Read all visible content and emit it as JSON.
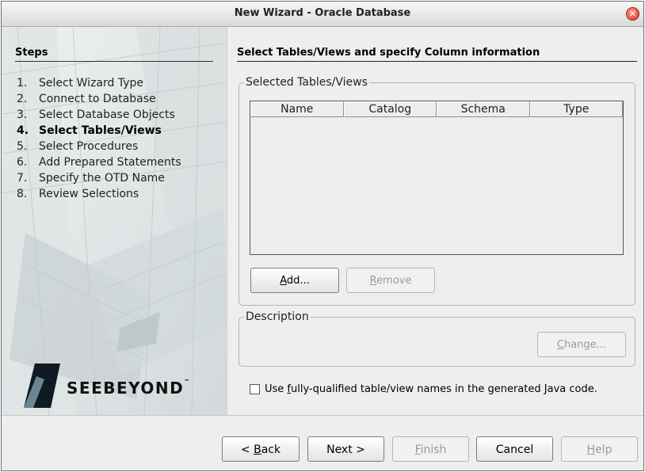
{
  "window": {
    "title": "New Wizard - Oracle Database"
  },
  "steps_panel": {
    "title": "Steps",
    "items": [
      {
        "num": "1.",
        "label": "Select Wizard Type",
        "current": false
      },
      {
        "num": "2.",
        "label": "Connect to Database",
        "current": false
      },
      {
        "num": "3.",
        "label": "Select Database Objects",
        "current": false
      },
      {
        "num": "4.",
        "label": "Select Tables/Views",
        "current": true
      },
      {
        "num": "5.",
        "label": "Select Procedures",
        "current": false
      },
      {
        "num": "6.",
        "label": "Add Prepared Statements",
        "current": false
      },
      {
        "num": "7.",
        "label": "Specify the OTD Name",
        "current": false
      },
      {
        "num": "8.",
        "label": "Review Selections",
        "current": false
      }
    ],
    "logo": {
      "text": "SEEBEYOND",
      "tm": "™"
    }
  },
  "main": {
    "title": "Select Tables/Views and specify Column information",
    "tables_group": {
      "legend": "Selected Tables/Views",
      "columns": [
        "Name",
        "Catalog",
        "Schema",
        "Type"
      ],
      "rows": []
    },
    "add_button": {
      "mnemonic": "A",
      "rest": "dd..."
    },
    "remove_button": {
      "mnemonic": "R",
      "rest": "emove"
    },
    "description_group": {
      "legend": "Description"
    },
    "change_button": {
      "mnemonic": "C",
      "rest": "hange..."
    },
    "checkbox": {
      "pre": "Use ",
      "mnemonic": "f",
      "post": "ully-qualified table/view names in the generated Java code.",
      "checked": false
    }
  },
  "footer": {
    "back": {
      "pre": "< ",
      "mnemonic": "B",
      "post": "ack"
    },
    "next": {
      "label": "Next >"
    },
    "finish": {
      "mnemonic": "F",
      "rest": "inish"
    },
    "cancel": {
      "label": "Cancel"
    },
    "help": {
      "mnemonic": "H",
      "rest": "elp"
    }
  },
  "colors": {
    "close_button": "#d5371c",
    "accent": "#6b8591"
  }
}
